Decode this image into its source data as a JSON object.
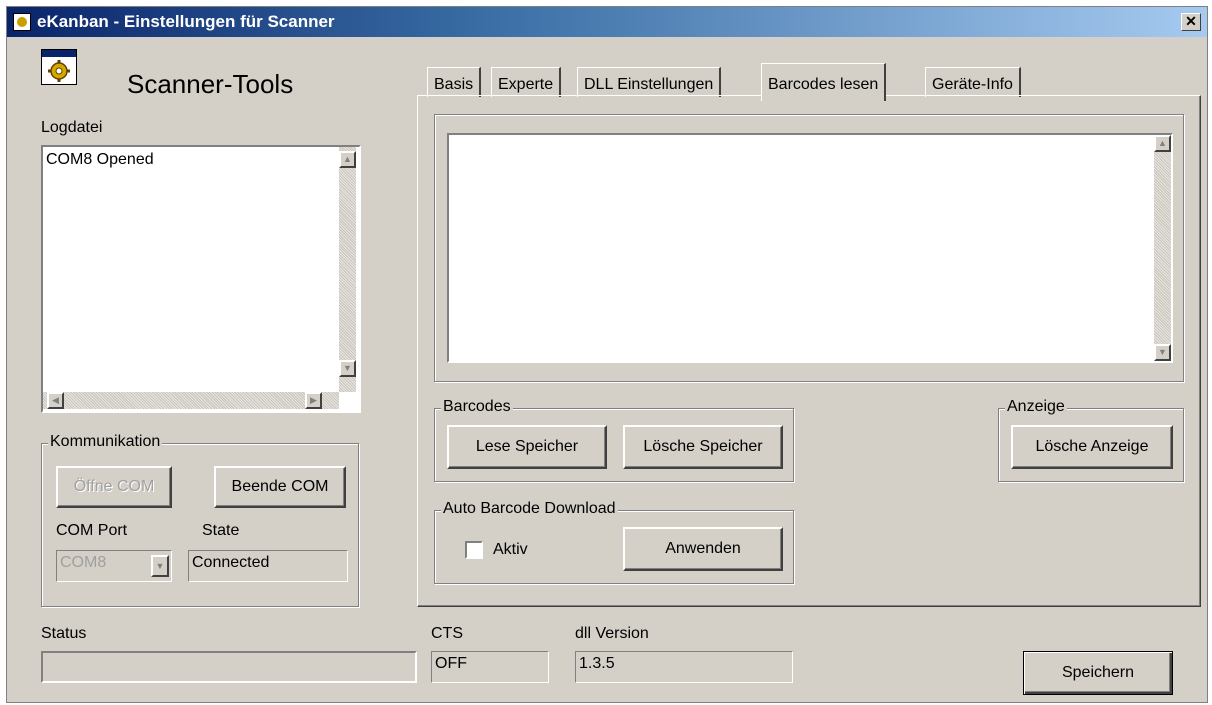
{
  "window": {
    "title": "eKanban - Einstellungen für Scanner",
    "close_glyph": "✕"
  },
  "header": {
    "title": "Scanner-Tools",
    "icon": "gear-app-icon"
  },
  "log": {
    "label": "Logdatei",
    "lines": [
      "COM8 Opened"
    ]
  },
  "communication": {
    "group_label": "Kommunikation",
    "open_label": "Öffne COM",
    "close_label": "Beende COM",
    "port_label": "COM Port",
    "state_label": "State",
    "port_value": "COM8",
    "state_value": "Connected"
  },
  "tabs": [
    {
      "label": "Basis"
    },
    {
      "label": "Experte"
    },
    {
      "label": "DLL Einstellungen"
    },
    {
      "label": "Barcodes lesen",
      "active": true
    },
    {
      "label": "Geräte-Info"
    }
  ],
  "barcodes": {
    "group_label": "Barcodes",
    "read_label": "Lese Speicher",
    "delete_label": "Lösche Speicher"
  },
  "display": {
    "group_label": "Anzeige",
    "clear_label": "Lösche Anzeige"
  },
  "auto_download": {
    "group_label": "Auto Barcode Download",
    "active_label": "Aktiv",
    "active_checked": false,
    "apply_label": "Anwenden"
  },
  "status": {
    "status_label": "Status",
    "status_value": "",
    "cts_label": "CTS",
    "cts_value": "OFF",
    "dll_label": "dll Version",
    "dll_value": "1.3.5"
  },
  "save_label": "Speichern"
}
